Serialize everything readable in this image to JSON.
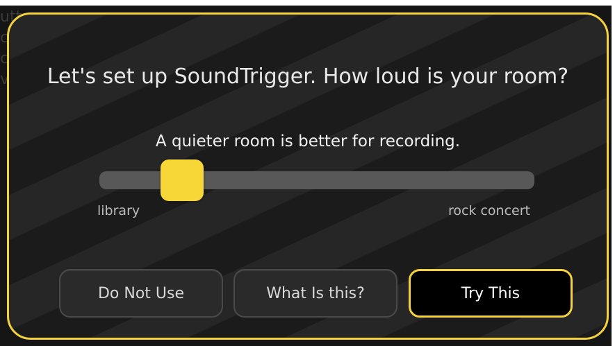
{
  "background": {
    "text_lines": [
      "uttor",
      "c",
      "c",
      "v"
    ]
  },
  "dialog": {
    "title": "Let's set up SoundTrigger. How loud is your room?",
    "subtitle": "A quieter room is better for recording.",
    "slider": {
      "min_label": "library",
      "max_label": "rock concert",
      "value_fraction": 0.19
    },
    "buttons": {
      "do_not_use": "Do Not Use",
      "what_is_this": "What Is this?",
      "try_this": "Try This"
    },
    "colors": {
      "accent": "#f4d23d",
      "thumb": "#f7d637",
      "track": "#585858",
      "background": "#222222"
    }
  }
}
